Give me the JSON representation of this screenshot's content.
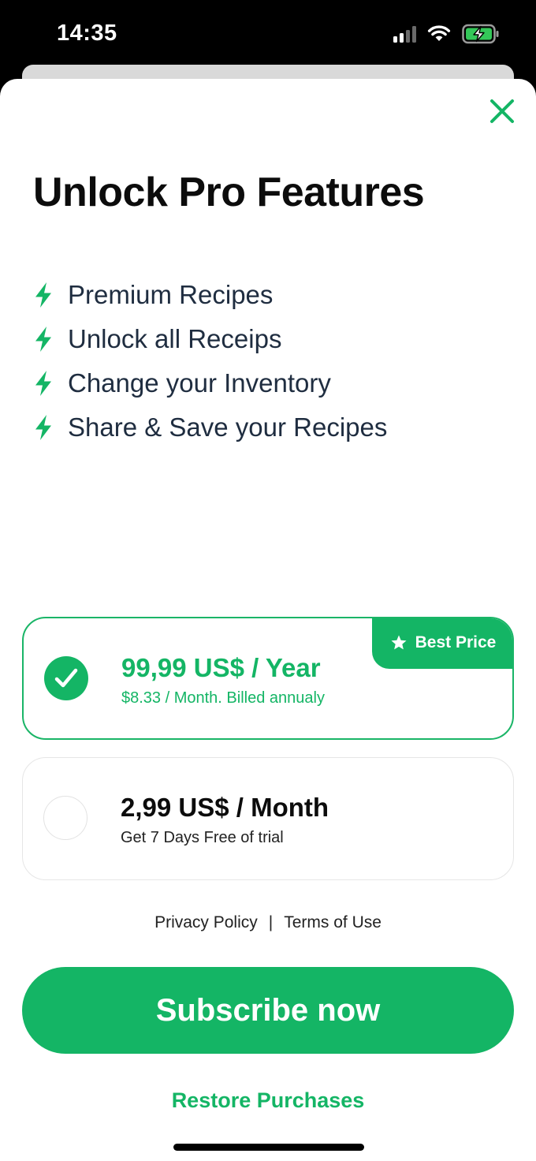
{
  "status_bar": {
    "time": "14:35",
    "icons": [
      "cellular-signal-icon",
      "wifi-icon",
      "battery-charging-icon"
    ]
  },
  "paywall": {
    "title": "Unlock Pro Features",
    "close_icon": "close-icon",
    "feature_icon": "lightning-bolt-icon",
    "features": [
      "Premium Recipes",
      "Unlock all Receips",
      "Change your Inventory",
      "Share & Save your Recipes"
    ],
    "plans": {
      "yearly": {
        "title": "99,99 US$ / Year",
        "subtitle": "$8.33 / Month. Billed annualy",
        "badge": "Best Price",
        "selected": true
      },
      "monthly": {
        "title": "2,99 US$ / Month",
        "subtitle": "Get 7 Days Free of trial",
        "selected": false
      }
    },
    "legal": {
      "privacy": "Privacy Policy",
      "separator": "|",
      "terms": "Terms of Use"
    },
    "subscribe_label": "Subscribe now",
    "restore_label": "Restore Purchases"
  },
  "colors": {
    "accent": "#14B565",
    "feature_text": "#1F2D40",
    "title_text": "#0C0C0C"
  }
}
